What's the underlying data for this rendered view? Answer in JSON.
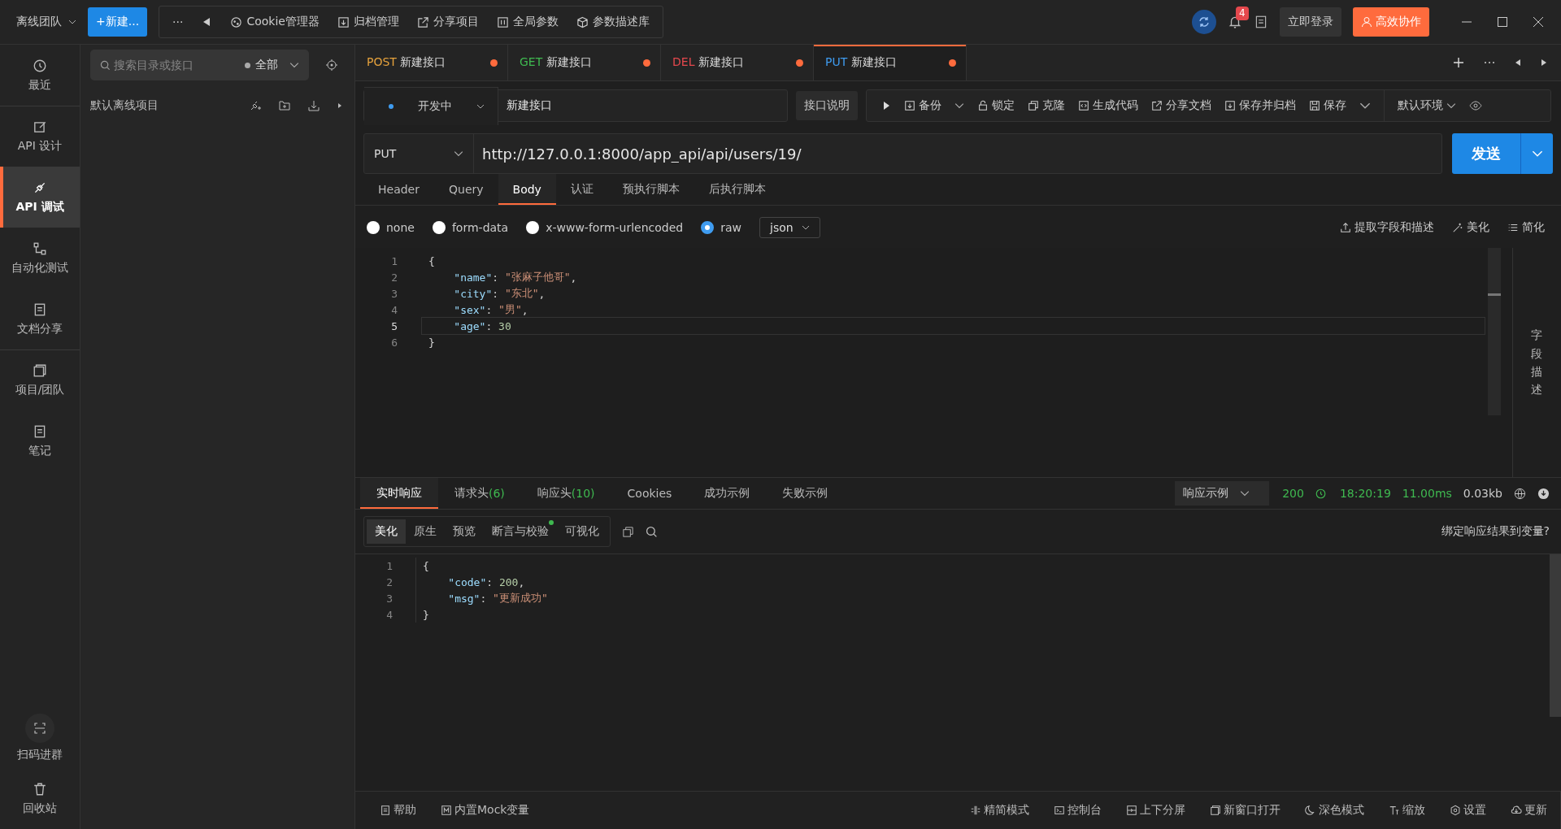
{
  "topbar": {
    "team": "离线团队",
    "new_button": "+新建...",
    "more": "···",
    "items": [
      {
        "kind": "cookie",
        "label": "Cookie管理器"
      },
      {
        "kind": "archive",
        "label": "归档管理"
      },
      {
        "kind": "share",
        "label": "分享项目"
      },
      {
        "kind": "params",
        "label": "全局参数"
      },
      {
        "kind": "cube",
        "label": "参数描述库"
      }
    ],
    "notification_count": "4",
    "login": "立即登录",
    "collab": "高效协作"
  },
  "nav": {
    "items": [
      {
        "kind": "clock",
        "label": "最近",
        "selected": false
      },
      {
        "kind": "edit",
        "label": "API 设计",
        "selected": false
      },
      {
        "kind": "plug",
        "label": "API 调试",
        "selected": true
      },
      {
        "kind": "flow",
        "label": "自动化测试",
        "selected": false
      },
      {
        "kind": "doc",
        "label": "文档分享",
        "selected": false
      },
      {
        "kind": "stack",
        "label": "项目/团队",
        "selected": false
      },
      {
        "kind": "note",
        "label": "笔记",
        "selected": false
      }
    ],
    "bottom": [
      {
        "kind": "scan",
        "label": "扫码进群"
      },
      {
        "kind": "trash",
        "label": "回收站"
      }
    ]
  },
  "tree": {
    "search_placeholder": "搜索目录或接口",
    "filter": "全部",
    "project": "默认离线项目"
  },
  "tabs": [
    {
      "method": "POST",
      "color": "#e6a23c",
      "title": "新建接口",
      "selected": false
    },
    {
      "method": "GET",
      "color": "#3fb950",
      "title": "新建接口",
      "selected": false
    },
    {
      "method": "DEL",
      "color": "#e5484d",
      "title": "新建接口",
      "selected": false
    },
    {
      "method": "PUT",
      "color": "#3f9cf0",
      "title": "新建接口",
      "selected": true
    }
  ],
  "request": {
    "status": "开发中",
    "name": "新建接口",
    "doc_button": "接口说明",
    "actions": [
      {
        "kind": "backup",
        "label": "备份"
      },
      {
        "kind": "lock",
        "label": "锁定"
      },
      {
        "kind": "clone",
        "label": "克隆"
      },
      {
        "kind": "code",
        "label": "生成代码"
      },
      {
        "kind": "share",
        "label": "分享文档"
      },
      {
        "kind": "archive",
        "label": "保存并归档"
      },
      {
        "kind": "save",
        "label": "保存"
      }
    ],
    "environment": "默认环境",
    "method": "PUT",
    "url": "http://127.0.0.1:8000/app_api/api/users/19/",
    "send": "发送"
  },
  "request_tabs": [
    {
      "label": "Header",
      "selected": false
    },
    {
      "label": "Query",
      "selected": false
    },
    {
      "label": "Body",
      "selected": true
    },
    {
      "label": "认证",
      "selected": false
    },
    {
      "label": "预执行脚本",
      "selected": false
    },
    {
      "label": "后执行脚本",
      "selected": false
    }
  ],
  "body_types": [
    {
      "label": "none",
      "selected": false
    },
    {
      "label": "form-data",
      "selected": false
    },
    {
      "label": "x-www-form-urlencoded",
      "selected": false
    },
    {
      "label": "raw",
      "selected": true
    }
  ],
  "raw_format": "json",
  "body_tools": [
    {
      "kind": "extract",
      "label": "提取字段和描述"
    },
    {
      "kind": "magic",
      "label": "美化"
    },
    {
      "kind": "list",
      "label": "简化"
    }
  ],
  "body_lines": [
    {
      "number": "1",
      "selected": false,
      "tokens": [
        {
          "kind": "punct",
          "text": "{"
        }
      ]
    },
    {
      "number": "2",
      "selected": false,
      "tokens": [
        {
          "kind": "key",
          "text": "    \"name\""
        },
        {
          "kind": "punct",
          "text": ": "
        },
        {
          "kind": "string",
          "text": "\"张麻子他哥\""
        },
        {
          "kind": "punct",
          "text": ","
        }
      ]
    },
    {
      "number": "3",
      "selected": false,
      "tokens": [
        {
          "kind": "key",
          "text": "    \"city\""
        },
        {
          "kind": "punct",
          "text": ": "
        },
        {
          "kind": "string",
          "text": "\"东北\""
        },
        {
          "kind": "punct",
          "text": ","
        }
      ]
    },
    {
      "number": "4",
      "selected": false,
      "tokens": [
        {
          "kind": "key",
          "text": "    \"sex\""
        },
        {
          "kind": "punct",
          "text": ": "
        },
        {
          "kind": "string",
          "text": "\"男\""
        },
        {
          "kind": "punct",
          "text": ","
        }
      ]
    },
    {
      "number": "5",
      "selected": true,
      "tokens": [
        {
          "kind": "key",
          "text": "    \"age\""
        },
        {
          "kind": "punct",
          "text": ": "
        },
        {
          "kind": "number",
          "text": "30"
        }
      ]
    },
    {
      "number": "6",
      "selected": false,
      "tokens": [
        {
          "kind": "punct",
          "text": "}"
        }
      ]
    }
  ],
  "field_description": "字段描述",
  "response_tabs": [
    {
      "label": "实时响应",
      "selected": true
    },
    {
      "label": "请求头",
      "count": "(6)",
      "selected": false
    },
    {
      "label": "响应头",
      "count": "(10)",
      "selected": false
    },
    {
      "label": "Cookies",
      "selected": false
    },
    {
      "label": "成功示例",
      "selected": false
    },
    {
      "label": "失败示例",
      "selected": false
    }
  ],
  "response_meta": {
    "example": "响应示例",
    "status": "200",
    "time": "18:20:19",
    "duration": "11.00ms",
    "size": "0.03kb"
  },
  "view_tabs": [
    {
      "label": "美化",
      "selected": true,
      "dot": false
    },
    {
      "label": "原生",
      "selected": false,
      "dot": false
    },
    {
      "label": "预览",
      "selected": false,
      "dot": false
    },
    {
      "label": "断言与校验",
      "selected": false,
      "dot": true
    },
    {
      "label": "可视化",
      "selected": false,
      "dot": false
    }
  ],
  "bind_link": "绑定响应结果到变量?",
  "response_lines": [
    {
      "number": "1",
      "tokens": [
        {
          "kind": "punct",
          "text": "{"
        }
      ]
    },
    {
      "number": "2",
      "tokens": [
        {
          "kind": "key",
          "text": "    \"code\""
        },
        {
          "kind": "punct",
          "text": ": "
        },
        {
          "kind": "number",
          "text": "200"
        },
        {
          "kind": "punct",
          "text": ","
        }
      ]
    },
    {
      "number": "3",
      "tokens": [
        {
          "kind": "key",
          "text": "    \"msg\""
        },
        {
          "kind": "punct",
          "text": ": "
        },
        {
          "kind": "string",
          "text": "\"更新成功\""
        }
      ]
    },
    {
      "number": "4",
      "tokens": [
        {
          "kind": "punct",
          "text": "}"
        }
      ]
    }
  ],
  "status_bar": {
    "left": [
      {
        "kind": "help",
        "label": "帮助"
      },
      {
        "kind": "mock",
        "label": "内置Mock变量"
      }
    ],
    "right": [
      {
        "kind": "compact",
        "label": "精简模式"
      },
      {
        "kind": "console",
        "label": "控制台"
      },
      {
        "kind": "split",
        "label": "上下分屏"
      },
      {
        "kind": "window",
        "label": "新窗口打开"
      },
      {
        "kind": "moon",
        "label": "深色模式"
      },
      {
        "kind": "font",
        "label": "缩放"
      },
      {
        "kind": "gear",
        "label": "设置"
      },
      {
        "kind": "cloud",
        "label": "更新"
      }
    ]
  }
}
